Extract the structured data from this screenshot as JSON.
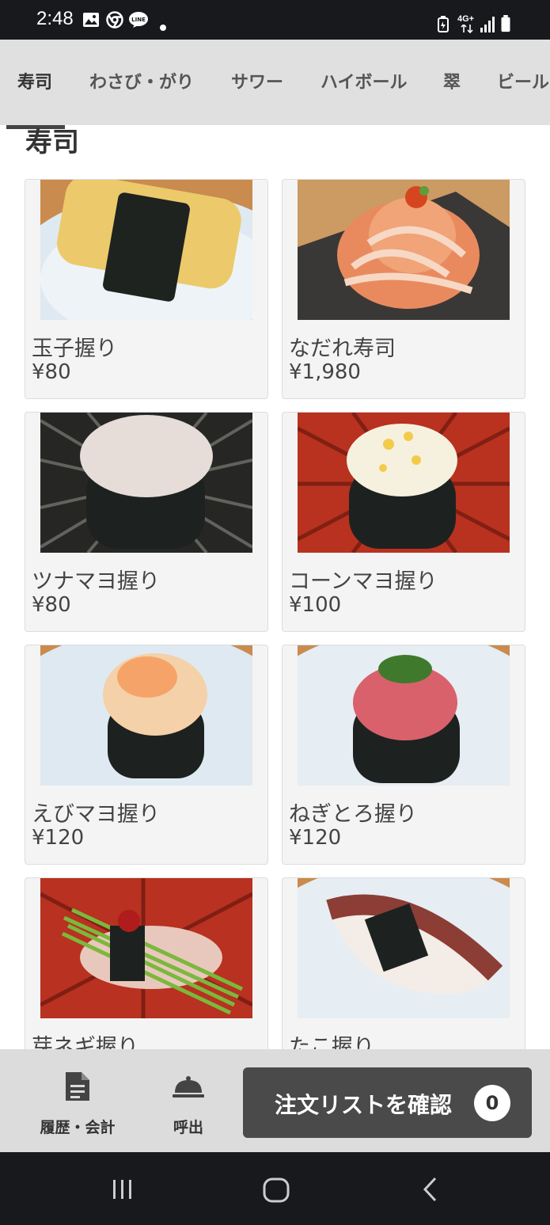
{
  "status_bar": {
    "time": "2:48",
    "left_icons": [
      "gallery-icon",
      "chrome-icon",
      "line-app-icon",
      "notification-dot-icon"
    ],
    "network": "4G+",
    "right_icons": [
      "battery-saver-icon",
      "network-4g-icon",
      "signal-icon",
      "battery-icon"
    ]
  },
  "tabs": [
    {
      "label": "寿司",
      "active": true
    },
    {
      "label": "わさび・がり",
      "active": false
    },
    {
      "label": "サワー",
      "active": false
    },
    {
      "label": "ハイボール",
      "active": false
    },
    {
      "label": "翠",
      "active": false
    },
    {
      "label": "ビール",
      "active": false
    }
  ],
  "section": {
    "title": "寿司"
  },
  "items": [
    {
      "name": "玉子握り",
      "price": "¥80",
      "photo": "tamago-nigiri-photo"
    },
    {
      "name": "なだれ寿司",
      "price": "¥1,980",
      "photo": "nadare-sushi-photo"
    },
    {
      "name": "ツナマヨ握り",
      "price": "¥80",
      "photo": "tuna-mayo-photo"
    },
    {
      "name": "コーンマヨ握り",
      "price": "¥100",
      "photo": "corn-mayo-photo"
    },
    {
      "name": "えびマヨ握り",
      "price": "¥120",
      "photo": "ebi-mayo-photo"
    },
    {
      "name": "ねぎとろ握り",
      "price": "¥120",
      "photo": "negitoro-photo"
    },
    {
      "name": "芽ネギ握り",
      "price": "",
      "photo": "menegi-photo"
    },
    {
      "name": "たこ握り",
      "price": "",
      "photo": "tako-photo"
    }
  ],
  "bottom_bar": {
    "history_label": "履歴・会計",
    "call_label": "呼出",
    "order_button_label": "注文リストを確認",
    "order_count": "0"
  },
  "colors": {
    "status_bar": "#17191c",
    "tab_bar": "#e0e0e0",
    "card_bg": "#f4f4f4",
    "order_button": "#4a4a4a",
    "bottom_bar": "#dcdcdc"
  }
}
